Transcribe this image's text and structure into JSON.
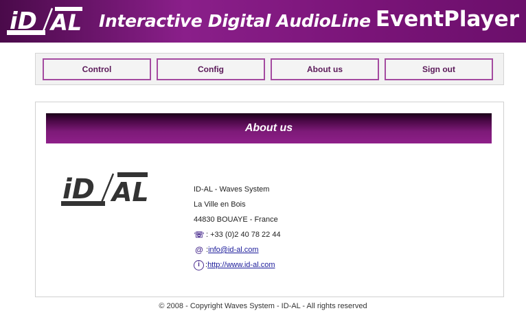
{
  "header": {
    "logo_text": "iD AL",
    "logo_small": "Interactive Digital",
    "logo_tag": "Audio Line",
    "title": "Interactive Digital AudioLine",
    "brand": "EventPlayer"
  },
  "nav": {
    "items": [
      {
        "label": "Control"
      },
      {
        "label": "Config"
      },
      {
        "label": "About us"
      },
      {
        "label": "Sign out"
      }
    ]
  },
  "about": {
    "section_title": "About us",
    "company": "ID-AL - Waves System",
    "address_line1": "La Ville en Bois",
    "address_line2": "44830 BOUAYE - France",
    "phone": ": +33 (0)2 40 78 22 44",
    "email": "info@id-al.com",
    "website": "http://www.id-al.com",
    "icons": [
      "phone-icon",
      "email-icon",
      "info-icon"
    ]
  },
  "footer": {
    "copyright": "© 2008 - Copyright Waves System - ID-AL - All rights reserved"
  },
  "colors": {
    "banner": "#7a1478",
    "nav_border": "#a44aa0",
    "section_bar": "#7d1a78",
    "link": "#1a1a9a",
    "icon": "#4a2d8f"
  }
}
